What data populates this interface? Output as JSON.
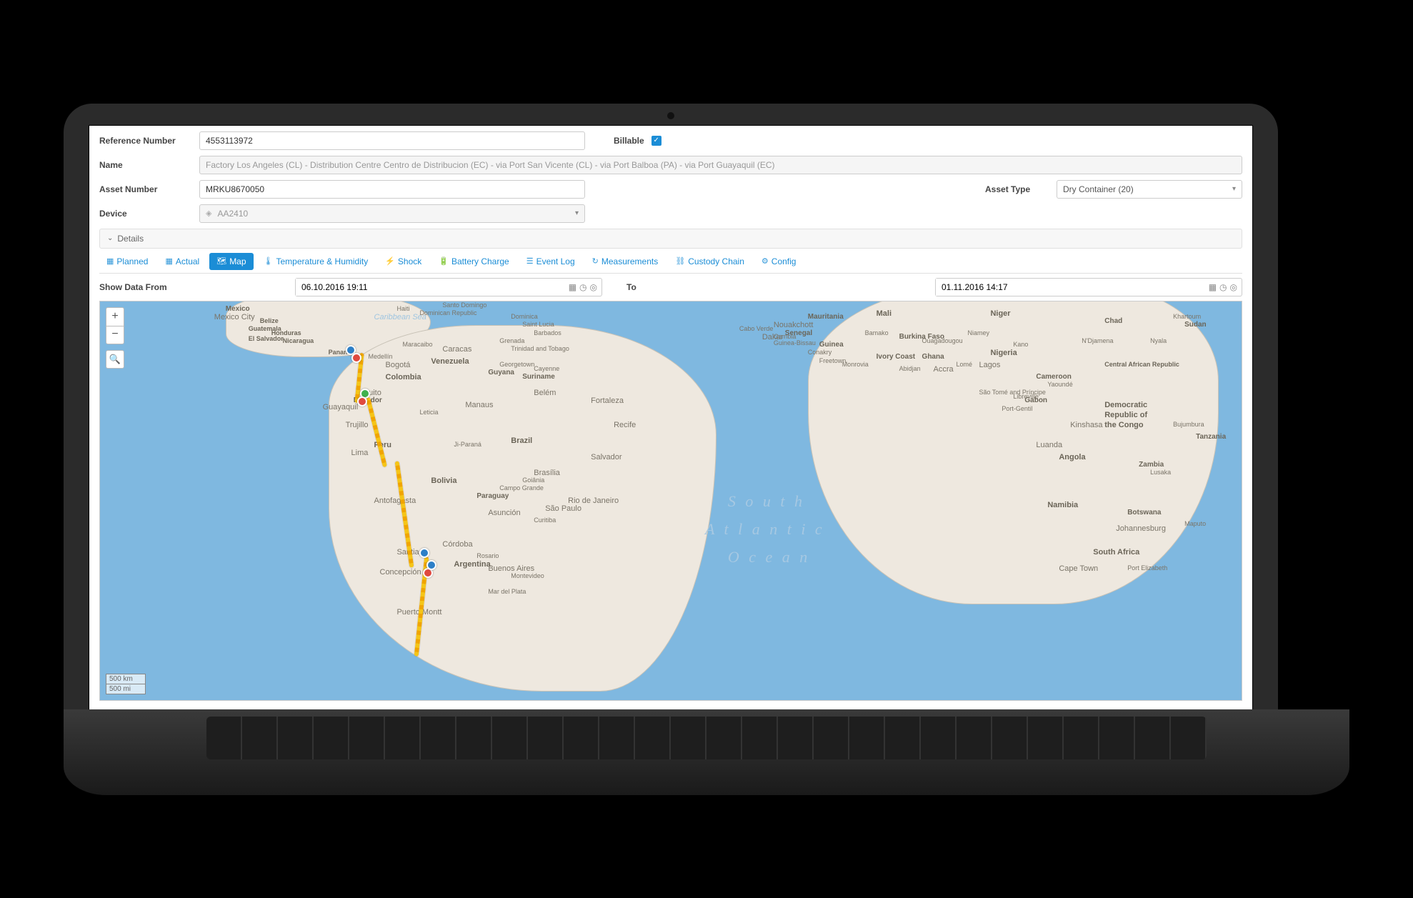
{
  "form": {
    "reference_label": "Reference Number",
    "reference_value": "4553113972",
    "billable_label": "Billable",
    "name_label": "Name",
    "name_value": "Factory Los Angeles (CL) - Distribution Centre Centro de Distribucion (EC) - via Port San Vicente (CL) - via Port Balboa (PA) - via Port Guayaquil (EC)",
    "asset_number_label": "Asset Number",
    "asset_number_value": "MRKU8670050",
    "asset_type_label": "Asset Type",
    "asset_type_value": "Dry Container (20)",
    "device_label": "Device",
    "device_value": "AA2410"
  },
  "details": {
    "label": "Details"
  },
  "tabs": {
    "planned": "Planned",
    "actual": "Actual",
    "map": "Map",
    "temp": "Temperature & Humidity",
    "shock": "Shock",
    "battery": "Battery Charge",
    "eventlog": "Event Log",
    "measurements": "Measurements",
    "custody": "Custody Chain",
    "config": "Config"
  },
  "date": {
    "from_label": "Show Data From",
    "from_value": "06.10.2016 19:11",
    "to_label": "To",
    "to_value": "01.11.2016 14:17"
  },
  "map": {
    "ocean_label_1": "S o u t h",
    "ocean_label_2": "A t l a n t i c",
    "ocean_label_3": "O c e a n",
    "caribbean": "Caribbean Sea",
    "countries": {
      "venezuela": "Venezuela",
      "colombia": "Colombia",
      "ecuador": "Ecuador",
      "peru": "Peru",
      "brazil": "Brazil",
      "bolivia": "Bolivia",
      "argentina": "Argentina",
      "paraguay": "Paraguay",
      "mali": "Mali",
      "niger": "Niger",
      "nigeria": "Nigeria",
      "chad": "Chad",
      "cameroon": "Cameroon",
      "drc1": "Democratic",
      "drc2": "Republic of",
      "drc3": "the Congo",
      "angola": "Angola",
      "namibia": "Namibia",
      "southafrica": "South Africa",
      "botswana": "Botswana",
      "zambia": "Zambia",
      "ghana": "Ghana",
      "ivory": "Ivory Coast",
      "guinea": "Guinea",
      "senegal": "Senegal",
      "burkina": "Burkina Faso",
      "mauritania": "Mauritania",
      "car": "Central African Republic",
      "gabon": "Gabon",
      "tanzania": "Tanzania",
      "mexico": "Mexico",
      "guatemala": "Guatemala",
      "honduras": "Honduras",
      "nicaragua": "Nicaragua",
      "panama": "Panama",
      "belize": "Belize",
      "haiti": "Haiti",
      "dr": "Dominican Republic",
      "elsalvador": "El Salvador",
      "guyana": "Guyana",
      "suriname": "Suriname",
      "sudan": "Sudan"
    },
    "cities": {
      "caracas": "Caracas",
      "bogota": "Bogotá",
      "quito": "Quito",
      "guayaquil": "Guayaquil",
      "lima": "Lima",
      "trujillo": "Trujillo",
      "antofagasta": "Antofagasta",
      "santiago": "Santiago",
      "concepcion": "Concepción",
      "buenosaires": "Buenos Aires",
      "cordoba": "Córdoba",
      "rosario": "Rosario",
      "montevideo": "Montevideo",
      "asuncion": "Asunción",
      "saopaulo": "São Paulo",
      "rio": "Rio de Janeiro",
      "brasilia": "Brasília",
      "salvador": "Salvador",
      "recife": "Recife",
      "fortaleza": "Fortaleza",
      "belem": "Belém",
      "manaus": "Manaus",
      "mexicocity": "Mexico City",
      "santodomingo": "Santo Domingo",
      "dakar": "Dakar",
      "accra": "Accra",
      "lagos": "Lagos",
      "abidjan": "Abidjan",
      "luanda": "Luanda",
      "capetown": "Cape Town",
      "johannesburg": "Johannesburg",
      "kinshasa": "Kinshasa",
      "maputo": "Maputo",
      "niamey": "Niamey",
      "ouagadougou": "Ouagadougou",
      "conakry": "Conakry",
      "bamako": "Bamako",
      "freetown": "Freetown",
      "monrovia": "Monrovia",
      "lome": "Lomé",
      "yaounde": "Yaoundé",
      "ndjamena": "N'Djamena",
      "puertomontt": "Puerto Montt",
      "mardelplata": "Mar del Plata",
      "leticia": "Leticia",
      "jiparana": "Ji-Paraná",
      "nouakchott": "Nouakchott",
      "portgentil": "Port-Gentil",
      "libreville": "Libreville",
      "khartoum": "Khartoum",
      "nyala": "Nyala",
      "portelizabeth": "Port Elizabeth",
      "lusaka": "Lusaka",
      "bujumbura": "Bujumbura",
      "kano": "Kano",
      "saotome": "São Tomé and Príncipe",
      "medellin": "Medellín",
      "maracaibo": "Maracaibo",
      "georgetown": "Georgetown",
      "cayenne": "Cayenne",
      "campo": "Campo Grande",
      "goiania": "Goiânia",
      "curitiba": "Curitiba",
      "grenada": "Grenada",
      "barbados": "Barbados",
      "stlucia": "Saint Lucia",
      "dominica": "Dominica",
      "trinidad": "Trinidad and Tobago",
      "caboverde": "Cabo Verde",
      "gambia": "Gambia",
      "guineabissau": "Guinea-Bissau"
    },
    "scale_km": "500 km",
    "scale_mi": "500 mi"
  }
}
